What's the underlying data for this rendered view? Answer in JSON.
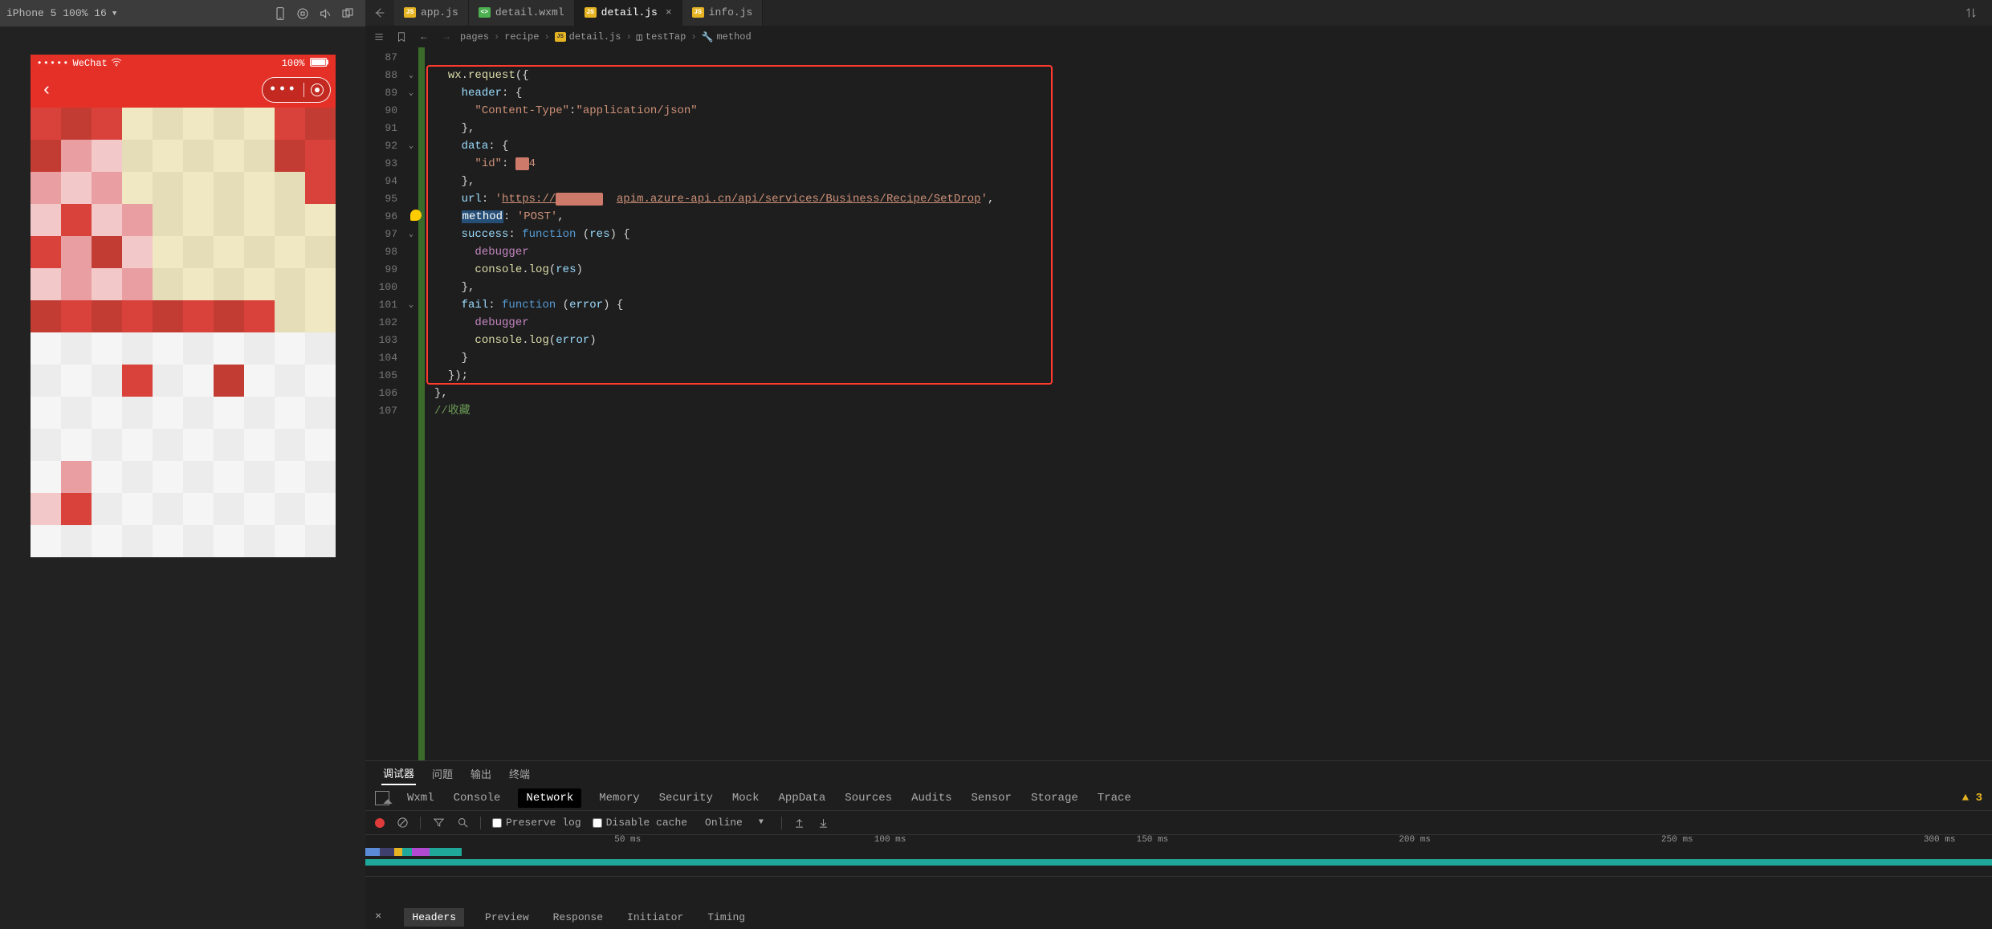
{
  "simulator": {
    "device_label": "iPhone 5 100% 16",
    "statusbar": {
      "carrier": "WeChat",
      "battery": "100%"
    }
  },
  "tabs": [
    {
      "name": "app.js",
      "type": "js",
      "active": false
    },
    {
      "name": "detail.wxml",
      "type": "wxml",
      "active": false
    },
    {
      "name": "detail.js",
      "type": "js",
      "active": true
    },
    {
      "name": "info.js",
      "type": "js",
      "active": false
    }
  ],
  "breadcrumb": {
    "parts": [
      "pages",
      "recipe",
      "detail.js",
      "testTap",
      "method"
    ]
  },
  "code": {
    "first_line_no": 87,
    "lines": [
      {
        "html": ""
      },
      {
        "html": "<span class='tk-obj'>wx</span><span class='tk-punc'>.</span><span class='tk-call'>request</span><span class='tk-punc'>({</span>"
      },
      {
        "html": "  <span class='tk-prop'>header</span><span class='tk-punc'>: {</span>"
      },
      {
        "html": "    <span class='tk-str'>\"Content-Type\"</span><span class='tk-punc'>:</span><span class='tk-str'>\"application/json\"</span>"
      },
      {
        "html": "  <span class='tk-punc'>},</span>"
      },
      {
        "html": "  <span class='tk-prop'>data</span><span class='tk-punc'>: {</span>"
      },
      {
        "html": "    <span class='tk-str'>\"id\"</span><span class='tk-punc'>: </span><span class='blur'>  </span><span class='tk-str'>4</span>"
      },
      {
        "html": "  <span class='tk-punc'>},</span>"
      },
      {
        "html": "  <span class='tk-prop'>url</span><span class='tk-punc'>: </span><span class='tk-str'>'</span><span class='tk-url'>https://</span><span class='blur'>n      </span>  <span class='tk-url'>apim.azure-api.cn/api/services/Business/Recipe/SetDrop</span><span class='tk-str'>'</span><span class='tk-punc'>,</span>"
      },
      {
        "html": "  <span class='sel-word'>method</span><span class='tk-punc'>: </span><span class='tk-str'>'POST'</span><span class='tk-punc'>,</span>"
      },
      {
        "html": "  <span class='tk-prop'>success</span><span class='tk-punc'>: </span><span class='tk-func'>function</span> <span class='tk-punc'>(</span><span class='tk-param'>res</span><span class='tk-punc'>) {</span>"
      },
      {
        "html": "    <span class='tk-dbg'>debugger</span>"
      },
      {
        "html": "    <span class='tk-obj'>console</span><span class='tk-punc'>.</span><span class='tk-call'>log</span><span class='tk-punc'>(</span><span class='tk-param'>res</span><span class='tk-punc'>)</span>"
      },
      {
        "html": "  <span class='tk-punc'>},</span>"
      },
      {
        "html": "  <span class='tk-prop'>fail</span><span class='tk-punc'>: </span><span class='tk-func'>function</span> <span class='tk-punc'>(</span><span class='tk-param'>error</span><span class='tk-punc'>) {</span>"
      },
      {
        "html": "    <span class='tk-dbg'>debugger</span>"
      },
      {
        "html": "    <span class='tk-obj'>console</span><span class='tk-punc'>.</span><span class='tk-call'>log</span><span class='tk-punc'>(</span><span class='tk-param'>error</span><span class='tk-punc'>)</span>"
      },
      {
        "html": "  <span class='tk-punc'>}</span>"
      },
      {
        "html": "<span class='tk-punc'>});</span>"
      },
      {
        "html": "<span class='tk-punc'>},</span>"
      },
      {
        "html": "<span class='tk-cmt'>//收藏</span>"
      }
    ],
    "fold_rows": [
      88,
      89,
      92,
      97,
      101
    ],
    "bulb_row": 96
  },
  "panel": {
    "tabs1": [
      "调试器",
      "问题",
      "输出",
      "终端"
    ],
    "tabs1_active": 0,
    "dev_tabs": [
      "Wxml",
      "Console",
      "Network",
      "Memory",
      "Security",
      "Mock",
      "AppData",
      "Sources",
      "Audits",
      "Sensor",
      "Storage",
      "Trace"
    ],
    "dev_active": 2,
    "warn_count": "3",
    "net_toolbar": {
      "preserve_log": "Preserve log",
      "disable_cache": "Disable cache",
      "throttling": "Online"
    },
    "timeline_ticks": [
      "50 ms",
      "100 ms",
      "150 ms",
      "200 ms",
      "250 ms",
      "300 ms"
    ],
    "timeline_segments": [
      {
        "color": "#5b8bd6",
        "w": 18
      },
      {
        "color": "#3f3f6e",
        "w": 18
      },
      {
        "color": "#e6b422",
        "w": 10
      },
      {
        "color": "#1fa89a",
        "w": 12
      },
      {
        "color": "#b24ad1",
        "w": 22
      },
      {
        "color": "#1fa89a",
        "w": 40
      }
    ],
    "req_tabs": [
      "Headers",
      "Preview",
      "Response",
      "Initiator",
      "Timing"
    ],
    "req_active": 0
  }
}
